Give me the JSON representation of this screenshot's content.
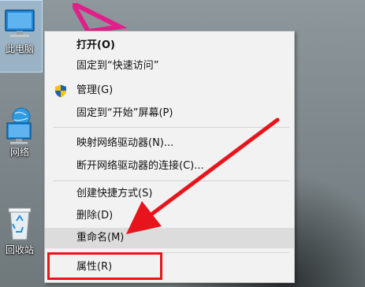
{
  "desktop": {
    "icons": [
      {
        "label": "此电脑"
      },
      {
        "label": "网络"
      },
      {
        "label": "回收站"
      }
    ]
  },
  "context_menu": {
    "items": [
      {
        "label": "打开(O)",
        "bold": true
      },
      {
        "label": "固定到“快速访问”"
      },
      {
        "label": "管理(G)",
        "icon": "shield-icon"
      },
      {
        "label": "固定到“开始”屏幕(P)"
      },
      {
        "label": "映射网络驱动器(N)..."
      },
      {
        "label": "断开网络驱动器的连接(C)..."
      },
      {
        "label": "创建快捷方式(S)"
      },
      {
        "label": "删除(D)"
      },
      {
        "label": "重命名(M)",
        "highlighted": true
      },
      {
        "label": "属性(R)"
      }
    ]
  },
  "annotations": {
    "highlight_color": "#e8141b",
    "arrow_color": "#e8141b"
  }
}
